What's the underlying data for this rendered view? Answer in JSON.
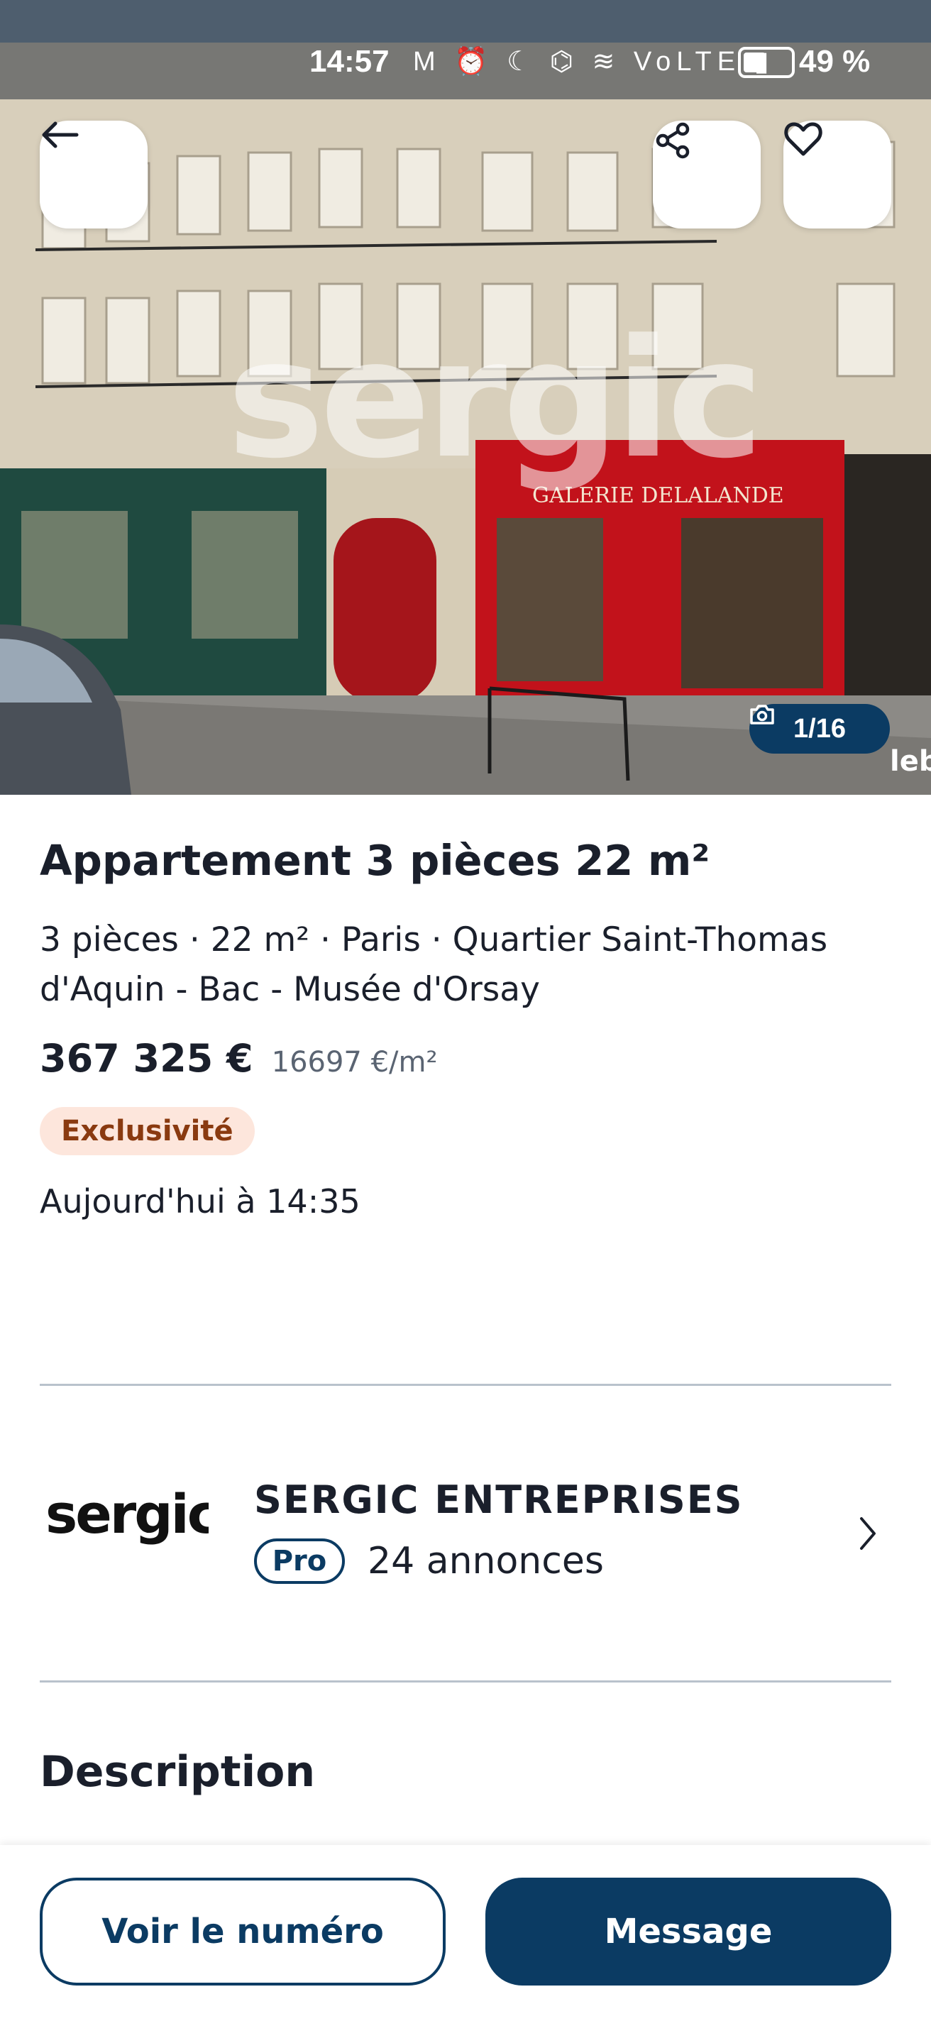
{
  "status_bar": {
    "time": "14:57",
    "icons": "M ⏰ ☾ ⌬ ≋ VoLTE ▮",
    "battery_percent_text": "49 %",
    "battery_level": 0.49
  },
  "photo": {
    "counter": "1/16",
    "watermark": "sergic",
    "storefront_sign": "GALERIE DELALANDE",
    "corner_mark": "leb"
  },
  "listing": {
    "title": "Appartement 3 pièces 22 m²",
    "subtitle": "3 pièces · 22 m² · Paris · Quartier Saint-Thomas d'Aquin - Bac - Musée d'Orsay",
    "price": "367 325 €",
    "price_per_m2": "16697 €/m²",
    "badge": "Exclusivité",
    "date": "Aujourd'hui à 14:35"
  },
  "seller": {
    "logo_text": "sergic",
    "name": "SERGIC ENTREPRISES",
    "pro_label": "Pro",
    "annonces": "24 annonces"
  },
  "description": {
    "title": "Description"
  },
  "actions": {
    "call_label": "Voir le numéro",
    "message_label": "Message"
  },
  "colors": {
    "brand": "#0b3b63",
    "badge_bg": "#fde6dc",
    "badge_text": "#8a3a10"
  }
}
